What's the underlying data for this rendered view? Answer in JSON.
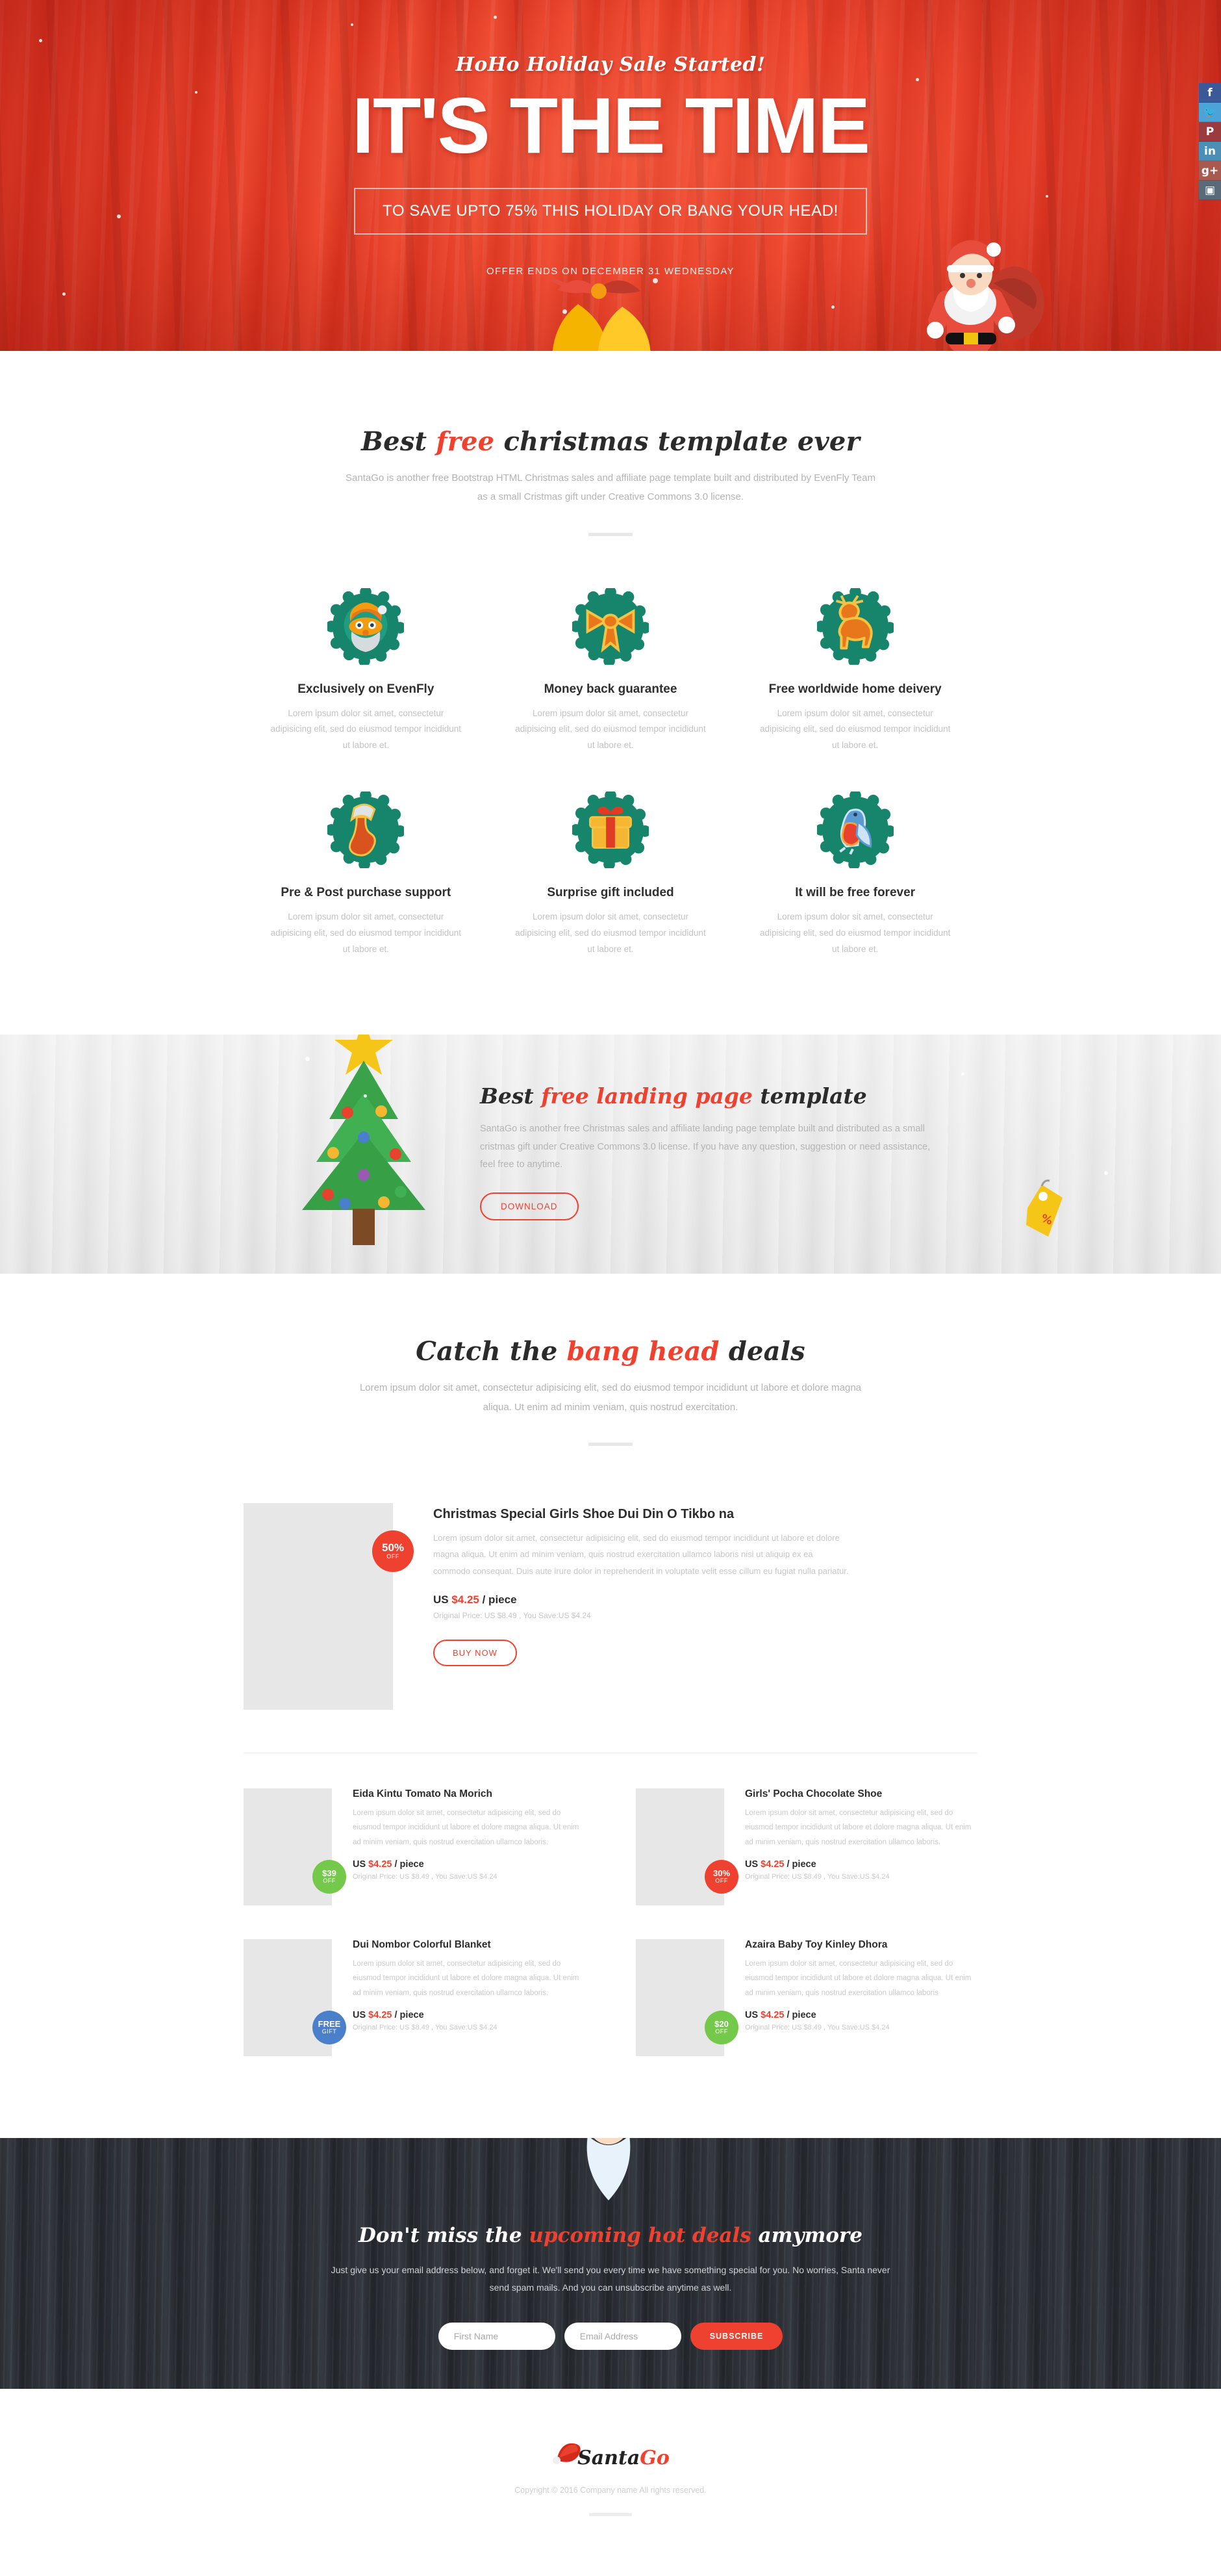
{
  "hero": {
    "kicker": "HoHo Holiday Sale Started!",
    "title": "IT'S THE TIME",
    "subtitle": "TO SAVE UPTO 75% THIS HOLIDAY OR BANG YOUR HEAD!",
    "offer_ends": "OFFER ENDS ON DECEMBER 31 WEDNESDAY",
    "social": [
      {
        "name": "facebook",
        "glyph": "f"
      },
      {
        "name": "twitter",
        "glyph": "🐦"
      },
      {
        "name": "pinterest",
        "glyph": "P"
      },
      {
        "name": "linkedin",
        "glyph": "in"
      },
      {
        "name": "googleplus",
        "glyph": "g+"
      },
      {
        "name": "instagram",
        "glyph": "▣"
      }
    ],
    "colors": {
      "bg": "#e03b24",
      "accent": "#ef4130"
    }
  },
  "features_section": {
    "heading_pre": "Best ",
    "heading_hl": "free",
    "heading_post": " christmas template ever",
    "lead": "SantaGo is another free Bootstrap HTML Christmas sales and affiliate page template built and distributed by EvenFly Team as a small Cristmas gift under Creative Commons 3.0 license.",
    "items": [
      {
        "icon": "santa-face-icon",
        "title": "Exclusively on EvenFly",
        "desc": "Lorem ipsum dolor sit amet, consectetur adipisicing elit, sed do eiusmod tempor incididunt ut labore et."
      },
      {
        "icon": "ribbon-bow-icon",
        "title": "Money back guarantee",
        "desc": "Lorem ipsum dolor sit amet, consectetur adipisicing elit, sed do eiusmod tempor incididunt ut labore et."
      },
      {
        "icon": "reindeer-icon",
        "title": "Free worldwide home deivery",
        "desc": "Lorem ipsum dolor sit amet, consectetur adipisicing elit, sed do eiusmod tempor incididunt ut labore et."
      },
      {
        "icon": "stocking-icon",
        "title": "Pre & Post purchase support",
        "desc": "Lorem ipsum dolor sit amet, consectetur adipisicing elit, sed do eiusmod tempor incididunt ut labore et."
      },
      {
        "icon": "gift-box-icon",
        "title": "Surprise gift included",
        "desc": "Lorem ipsum dolor sit amet, consectetur adipisicing elit, sed do eiusmod tempor incididunt ut labore et."
      },
      {
        "icon": "bird-icon",
        "title": "It will be free forever",
        "desc": "Lorem ipsum dolor sit amet, consectetur adipisicing elit, sed do eiusmod tempor incididunt ut labore et."
      }
    ]
  },
  "landing_band": {
    "heading_pre": "Best ",
    "heading_hl": "free landing page",
    "heading_post": " template",
    "paragraph": "SantaGo is another free Christmas sales and affiliate landing page template built and distributed as a small cristmas gift under Creative Commons 3.0 license. If you have any question, suggestion or need assistance, feel free to anytime.",
    "download_label": "DOWNLOAD"
  },
  "deals_section": {
    "heading_pre": "Catch the ",
    "heading_hl": "bang head",
    "heading_post": " deals",
    "lead": "Lorem ipsum dolor sit amet, consectetur adipisicing elit, sed do eiusmod tempor incididunt ut labore et dolore magna aliqua. Ut enim ad minim veniam, quis nostrud exercitation.",
    "featured": {
      "badge_value": "50%",
      "badge_label": "OFF",
      "badge_color": "#ef4130",
      "title": "Christmas Special Girls Shoe Dui Din O Tikbo na",
      "desc": "Lorem ipsum dolor sit amet, consectetur adipisicing elit, sed do eiusmod tempor incididunt ut labore et dolore magna aliqua. Ut enim ad minim veniam, quis nostrud exercitation ullamco laboris nisi ut aliquip ex ea commodo consequat. Duis aute irure dolor in reprehenderit in voluptate velit esse cillum eu fugiat nulla pariatur.",
      "price_prefix": "US ",
      "price_amount": "$4.25",
      "price_suffix": " / piece",
      "original": "Original Price: US $8.49 , You Save:US $4.24",
      "buy_label": "BUY NOW"
    },
    "cards": [
      {
        "badge_value": "$39",
        "badge_label": "OFF",
        "badge_class": "badge-green",
        "title": "Eida Kintu Tomato Na Morich",
        "desc": "Lorem ipsum dolor sit amet, consectetur adipisicing elit, sed do eiusmod tempor incididunt ut labore et dolore magna aliqua. Ut enim ad minim veniam, quis nostrud exercitation ullamco laboris.",
        "price_prefix": "US ",
        "price_amount": "$4.25",
        "price_suffix": " / piece",
        "original": "Original Price: US $8.49 , You Save:US $4.24"
      },
      {
        "badge_value": "30%",
        "badge_label": "OFF",
        "badge_class": "badge-red",
        "title": "Girls' Pocha Chocolate Shoe",
        "desc": "Lorem ipsum dolor sit amet, consectetur adipisicing elit, sed do eiusmod tempor incididunt ut labore et dolore magna aliqua. Ut enim ad minim veniam, quis nostrud exercitation ullamco laboris.",
        "price_prefix": "US ",
        "price_amount": "$4.25",
        "price_suffix": " / piece",
        "original": "Original Price: US $8.49 , You Save:US $4.24"
      },
      {
        "badge_value": "FREE",
        "badge_label": "GIFT",
        "badge_class": "badge-blue",
        "title": "Dui Nombor Colorful Blanket",
        "desc": "Lorem ipsum dolor sit amet, consectetur adipisicing elit, sed do eiusmod tempor incididunt ut labore et dolore magna aliqua. Ut enim ad minim veniam, quis nostrud exercitation ullamco laboris.",
        "price_prefix": "US ",
        "price_amount": "$4.25",
        "price_suffix": " / piece",
        "original": "Original Price: US $8.49 , You Save:US $4.24"
      },
      {
        "badge_value": "$20",
        "badge_label": "OFF",
        "badge_class": "badge-green",
        "title": "Azaira Baby Toy Kinley Dhora",
        "desc": "Lorem ipsum dolor sit amet, consectetur adipisicing elit, sed do eiusmod tempor incididunt ut labore et dolore magna aliqua. Ut enim ad minim veniam, quis nostrud exercitation ullamco laboris",
        "price_prefix": "US ",
        "price_amount": "$4.25",
        "price_suffix": " / piece",
        "original": "Original Price: US $8.49 , You Save:US $4.24"
      }
    ]
  },
  "newsletter": {
    "heading_pre": "Don't miss the ",
    "heading_hl": "upcoming hot deals",
    "heading_post": " amymore",
    "paragraph": "Just give us your email address below, and forget it. We'll send you every time we have something special for you. No worries, Santa never send spam mails. And you can unsubscribe anytime as well.",
    "first_name_placeholder": "First Name",
    "first_name_value": "",
    "email_placeholder": "Email Address",
    "email_value": "",
    "subscribe_label": "SUBSCRIBE"
  },
  "footer": {
    "logo_main": "Santa",
    "logo_accent": "Go",
    "copyright": "Copyright © 2016 Company name All rights reserved."
  }
}
